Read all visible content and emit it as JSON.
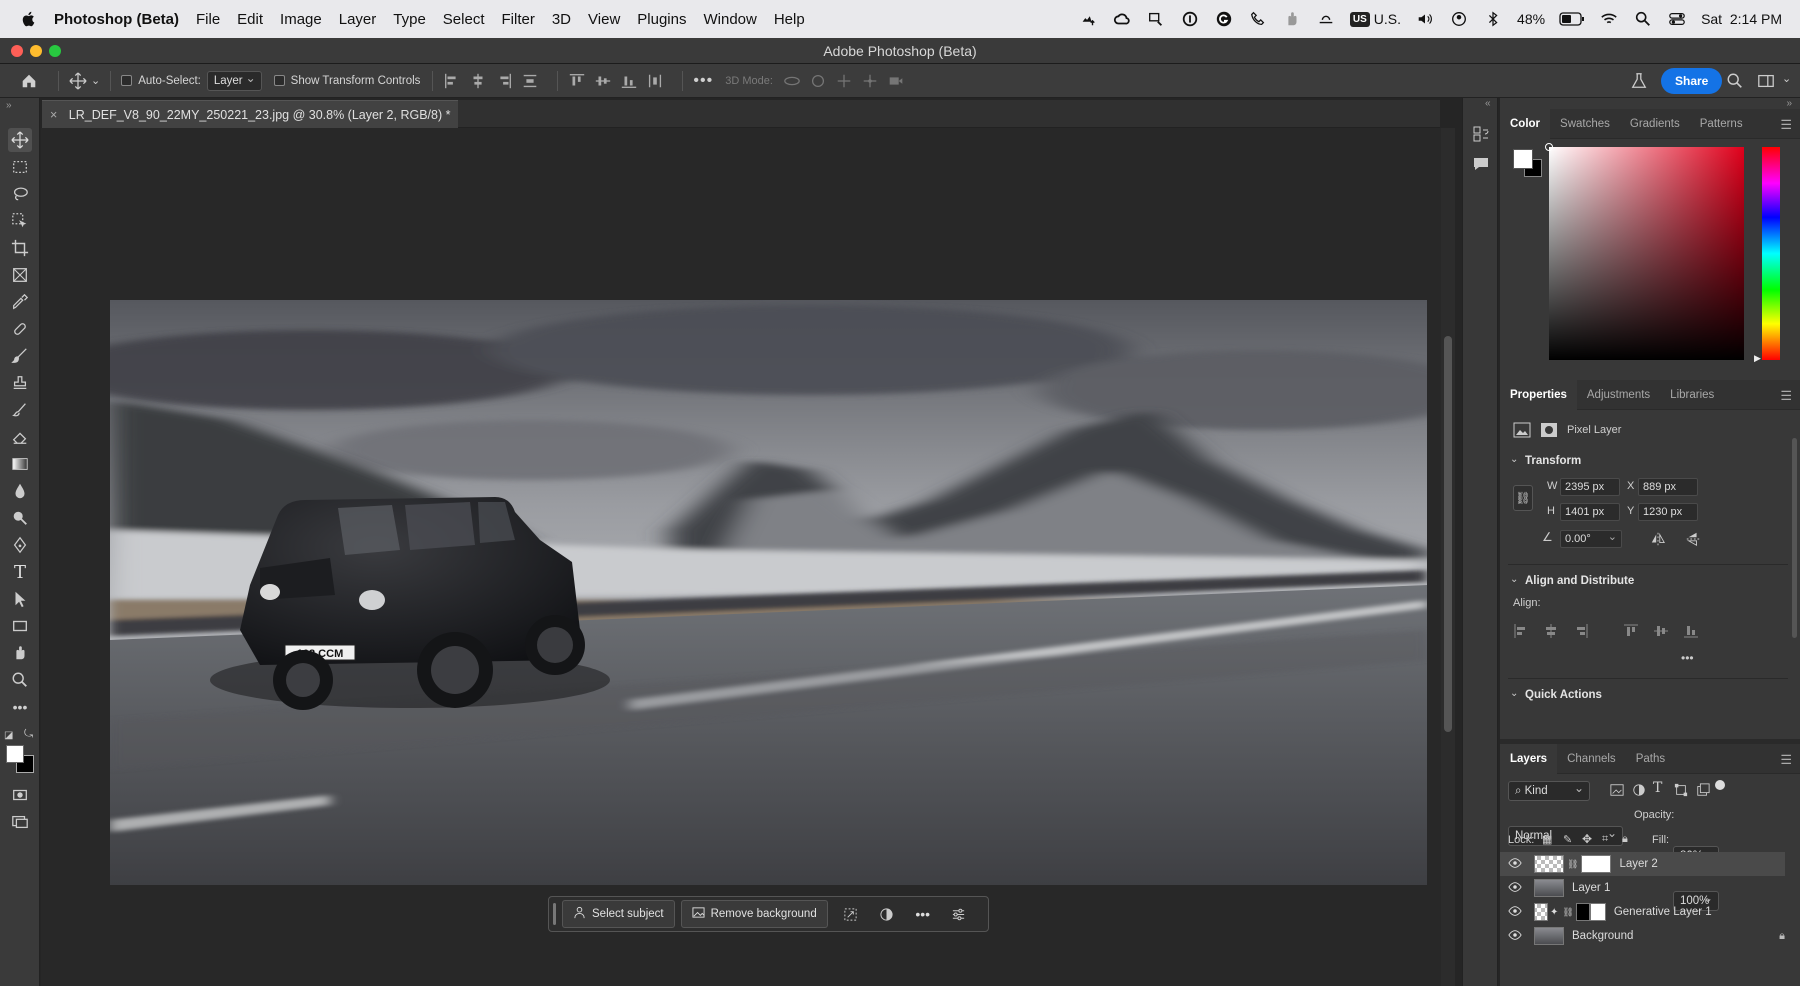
{
  "menubar": {
    "app_name": "Photoshop (Beta)",
    "items": [
      "File",
      "Edit",
      "Image",
      "Layer",
      "Type",
      "Select",
      "Filter",
      "3D",
      "View",
      "Plugins",
      "Window",
      "Help"
    ],
    "keyboard_badge": "US",
    "keyboard_label": "U.S.",
    "battery": "48%",
    "clock": "Sat  2:14 PM"
  },
  "window": {
    "title": "Adobe Photoshop (Beta)"
  },
  "options": {
    "auto_select_label": "Auto-Select:",
    "auto_select_value": "Layer",
    "transform_label": "Show Transform Controls",
    "mode_3d_label": "3D Mode:",
    "share_label": "Share"
  },
  "document": {
    "tab_title": "LR_DEF_V8_90_22MY_250221_23.jpg @ 30.8% (Layer 2, RGB/8) *",
    "plate_text": "108 CCM"
  },
  "taskbar": {
    "select_subject": "Select subject",
    "remove_background": "Remove background"
  },
  "color_panel": {
    "tabs": [
      "Color",
      "Swatches",
      "Gradients",
      "Patterns"
    ],
    "active_tab": "Color"
  },
  "properties_panel": {
    "tabs": [
      "Properties",
      "Adjustments",
      "Libraries"
    ],
    "layer_kind": "Pixel Layer",
    "transform_title": "Transform",
    "w_label": "W",
    "w_value": "2395 px",
    "h_label": "H",
    "h_value": "1401 px",
    "x_label": "X",
    "x_value": "889 px",
    "y_label": "Y",
    "y_value": "1230 px",
    "angle_value": "0.00°",
    "align_title": "Align and Distribute",
    "align_label": "Align:",
    "quick_actions_title": "Quick Actions"
  },
  "layers_panel": {
    "tabs": [
      "Layers",
      "Channels",
      "Paths"
    ],
    "filter_kind": "Kind",
    "blend_mode": "Normal",
    "opacity_label": "Opacity:",
    "opacity_value": "80%",
    "lock_label": "Lock:",
    "fill_label": "Fill:",
    "fill_value": "100%",
    "layers": [
      "Layer 2",
      "Layer 1",
      "Generative Layer 1",
      "Background"
    ]
  }
}
